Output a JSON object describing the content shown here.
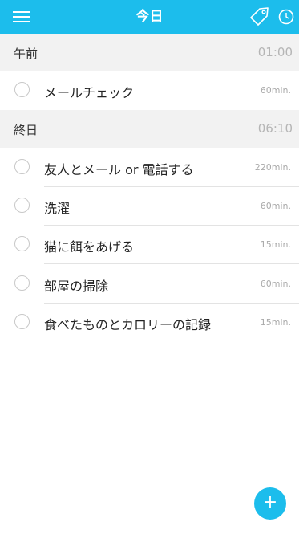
{
  "header": {
    "title": "今日",
    "icons": {
      "menu": "hamburger-menu-icon",
      "tag": "tag-icon",
      "clock": "clock-icon"
    }
  },
  "sections": [
    {
      "label": "午前",
      "time": "01:00"
    },
    {
      "label": "終日",
      "time": "06:10"
    }
  ],
  "tasks": [
    {
      "name": "メールチェック",
      "duration": "60min."
    },
    {
      "name": "友人とメール or 電話する",
      "duration": "220min."
    },
    {
      "name": "洗濯",
      "duration": "60min."
    },
    {
      "name": "猫に餌をあげる",
      "duration": "15min."
    },
    {
      "name": "部屋の掃除",
      "duration": "60min."
    },
    {
      "name": "食べたものとカロリーの記録",
      "duration": "15min."
    }
  ],
  "fab": {
    "label": "+"
  },
  "colors": {
    "accent": "#1cbdec",
    "section_bg": "#f2f2f2"
  }
}
